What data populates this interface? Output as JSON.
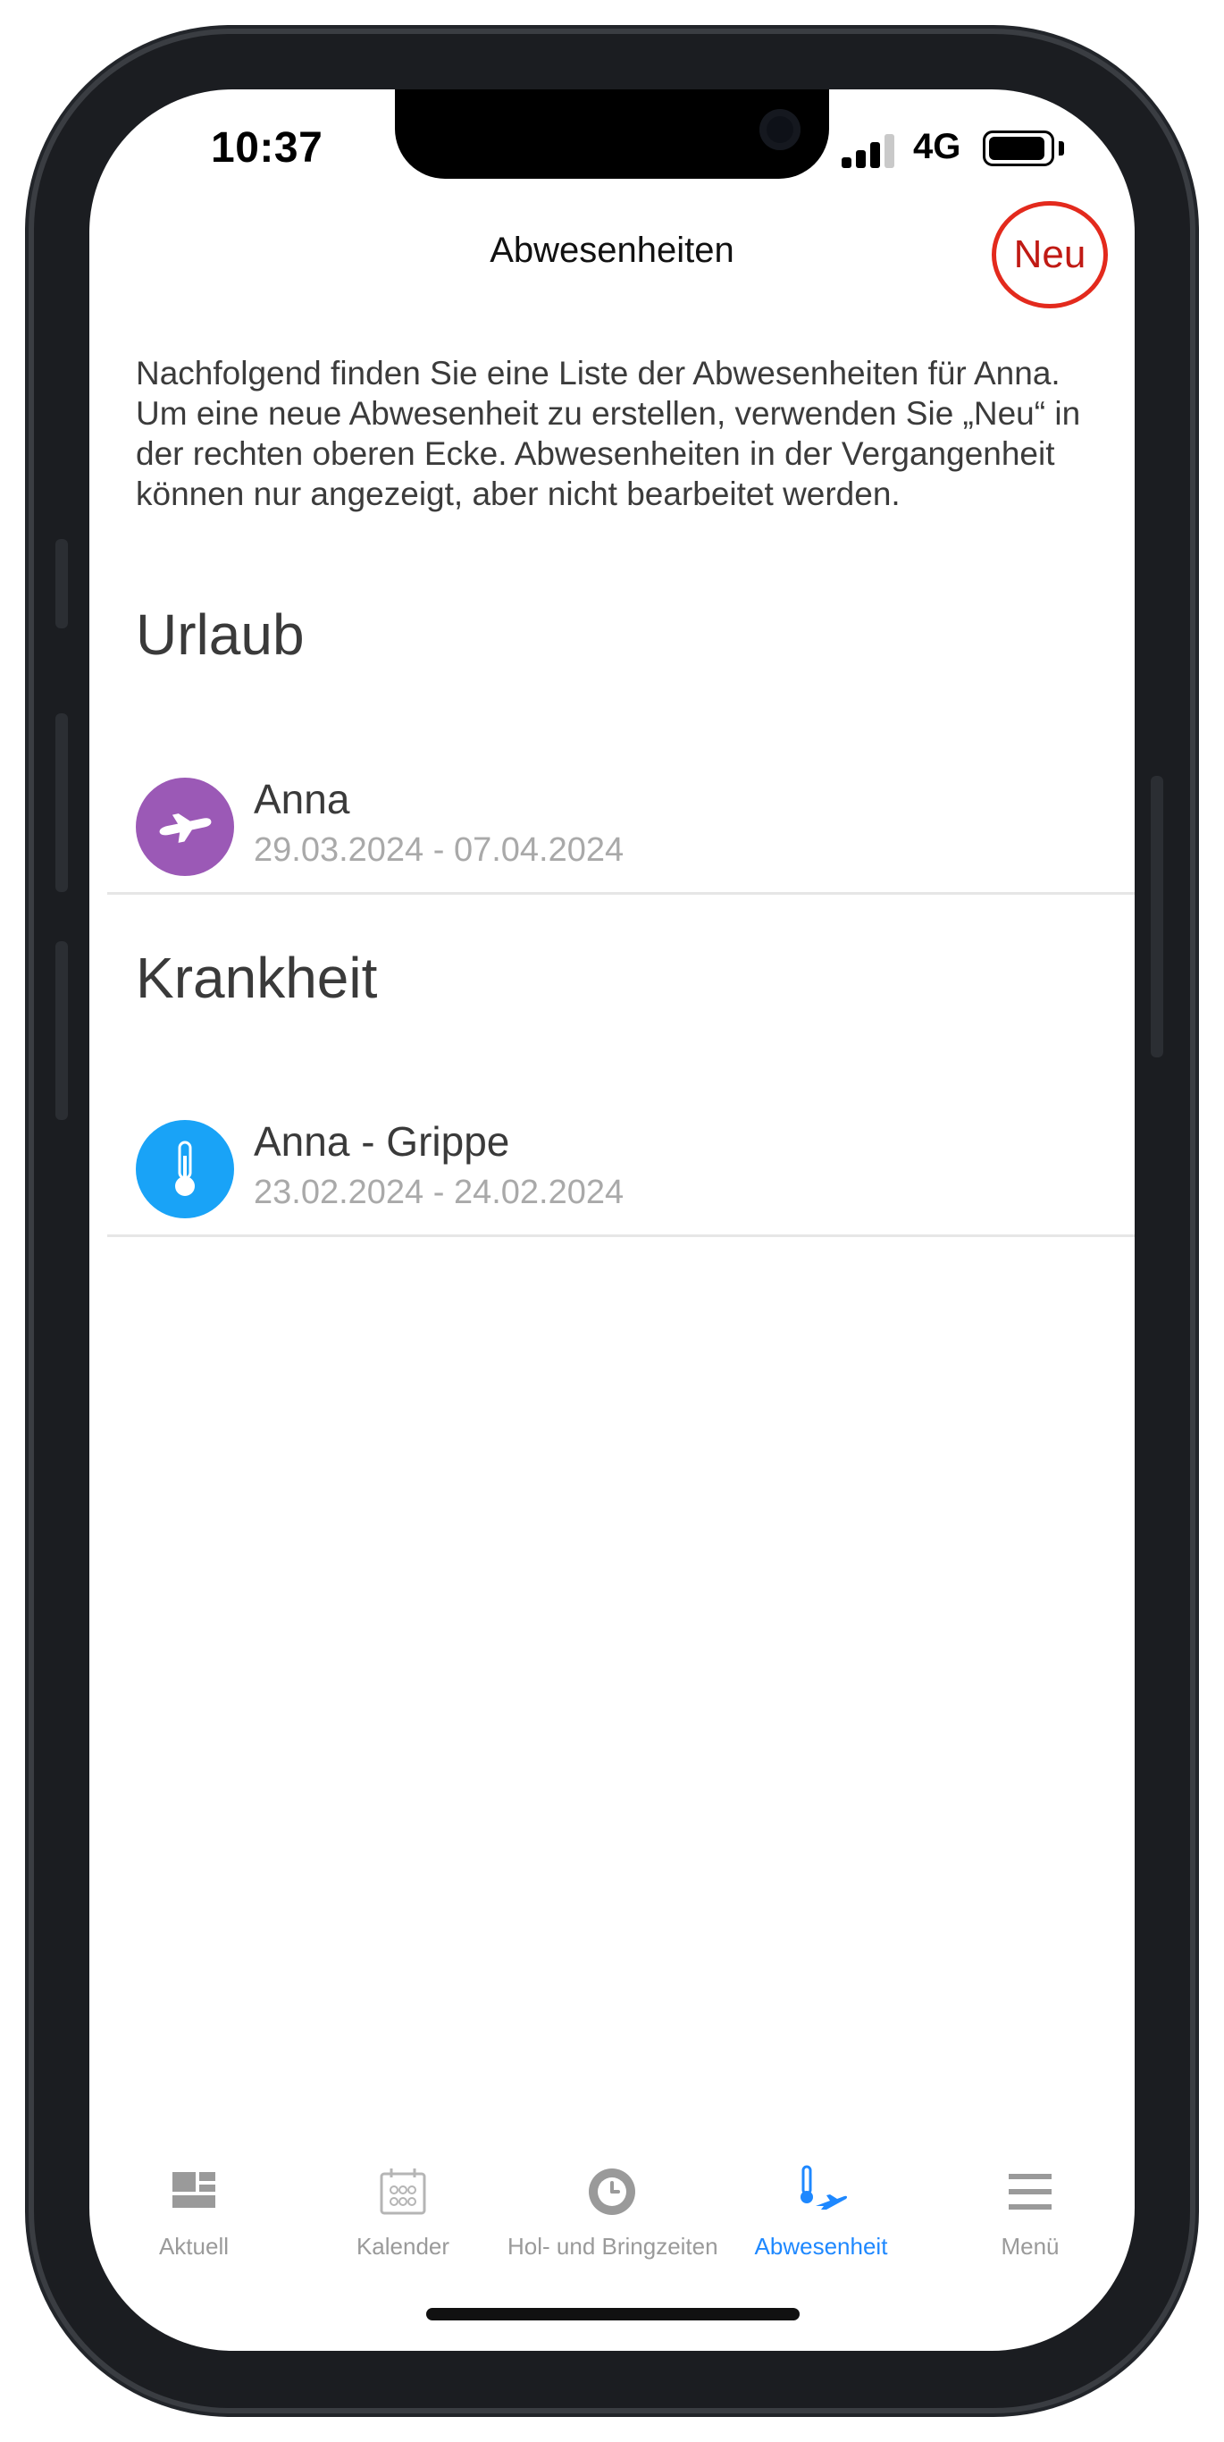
{
  "status_bar": {
    "time": "10:37",
    "network": "4G"
  },
  "header": {
    "title": "Abwesenheiten",
    "new_label": "Neu"
  },
  "intro_text": "Nachfolgend finden Sie eine Liste der Abwesenheiten für Anna. Um eine neue Abwesenheit zu erstellen, verwenden Sie „Neu“ in der rechten oberen Ecke. Abwesenheiten in der Vergangenheit können nur angezeigt, aber nicht bearbeitet werden.",
  "sections": [
    {
      "title": "Urlaub",
      "items": [
        {
          "title": "Anna",
          "subtitle": "29.03.2024 - 07.04.2024",
          "icon": "airplane-icon",
          "color": "#9b59b6"
        }
      ]
    },
    {
      "title": "Krankheit",
      "items": [
        {
          "title": "Anna - Grippe",
          "subtitle": "23.02.2024 - 24.02.2024",
          "icon": "thermometer-icon",
          "color": "#19a3f7"
        }
      ]
    }
  ],
  "tabs": [
    {
      "label": "Aktuell",
      "icon": "dashboard-icon",
      "active": false
    },
    {
      "label": "Kalender",
      "icon": "calendar-icon",
      "active": false
    },
    {
      "label": "Hol- und Bringzeiten",
      "icon": "clock-icon",
      "active": false
    },
    {
      "label": "Abwesenheit",
      "icon": "absence-icon",
      "active": true
    },
    {
      "label": "Menü",
      "icon": "menu-icon",
      "active": false
    }
  ],
  "colors": {
    "accent": "#1e88ff",
    "new_highlight": "#e32a1d",
    "inactive_tab": "#9a9a9a"
  }
}
